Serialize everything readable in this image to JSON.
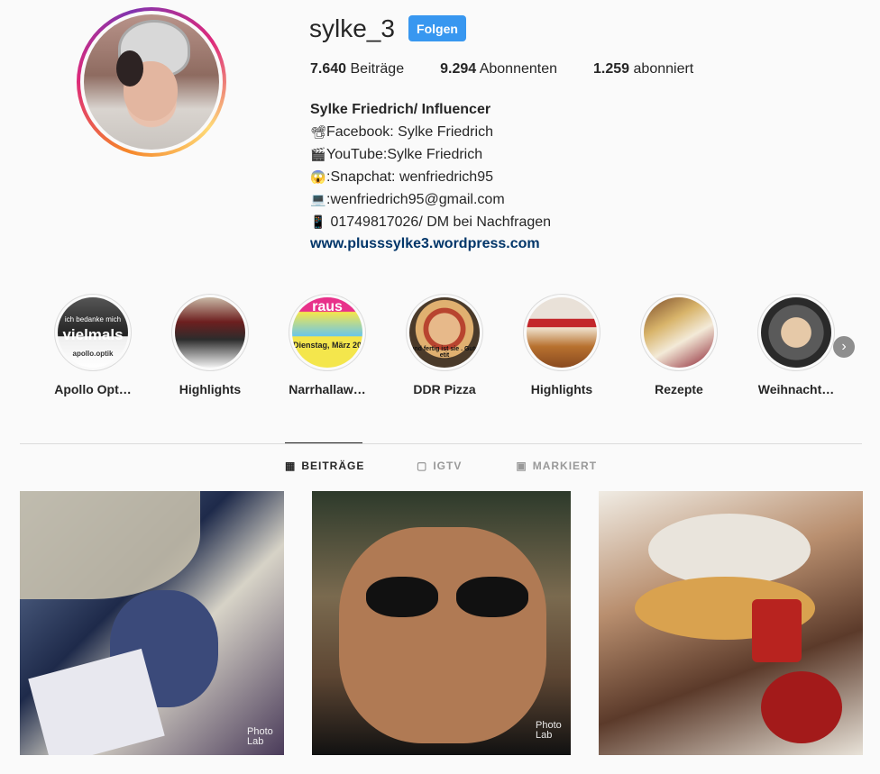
{
  "profile": {
    "username": "sylke_3",
    "follow_label": "Folgen",
    "stats": {
      "posts_count": "7.640",
      "posts_label": "Beiträge",
      "followers_count": "9.294",
      "followers_label": "Abonnenten",
      "following_count": "1.259",
      "following_label": "abonniert"
    },
    "bio": {
      "name": "Sylke Friedrich/ Influencer",
      "lines": [
        {
          "emoji": "📽",
          "text": "Facebook: Sylke Friedrich"
        },
        {
          "emoji": "🎬",
          "text": "YouTube:Sylke Friedrich"
        },
        {
          "emoji": "😱",
          "text": ":Snapchat: wenfriedrich95"
        },
        {
          "emoji": "💻",
          "text": ":wenfriedrich95@gmail.com"
        },
        {
          "emoji": "📱",
          "text": " 01749817026/ DM bei Nachfragen"
        }
      ],
      "link": "www.plusssylke3.wordpress.com"
    }
  },
  "highlights": [
    {
      "label": "Apollo Opt…",
      "overlay": "vielmals",
      "overlay_small": "apollo.optik",
      "overlay_top": "ich bedanke mich"
    },
    {
      "label": "Highlights"
    },
    {
      "label": "Narrhallaw…",
      "overlay": "raus",
      "overlay_small": "Dienstag, März 20"
    },
    {
      "label": "DDR Pizza",
      "overlay_small": "und fertig ist sie . Gute etit"
    },
    {
      "label": "Highlights"
    },
    {
      "label": "Rezepte"
    },
    {
      "label": "Weihnacht…"
    }
  ],
  "highlights_next_icon": "chevron-right-icon",
  "tabs": [
    {
      "label": "BEITRÄGE",
      "icon": "grid-icon",
      "active": true
    },
    {
      "label": "IGTV",
      "icon": "tv-icon",
      "active": false
    },
    {
      "label": "MARKIERT",
      "icon": "tag-person-icon",
      "active": false
    }
  ],
  "posts": [
    {
      "watermark": "Photo Lab"
    },
    {
      "watermark": "Photo Lab"
    },
    {
      "watermark": ""
    }
  ],
  "colors": {
    "follow_button": "#3897f0",
    "link": "#003569",
    "text": "#262626",
    "muted": "#999999"
  }
}
